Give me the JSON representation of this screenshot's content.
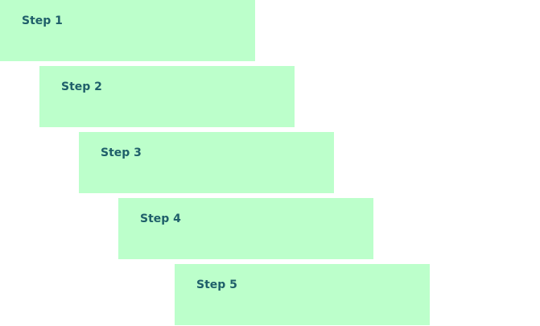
{
  "theme": {
    "box_color": "#bcffcb",
    "text_color": "#1f5f6a",
    "background": "#ffffff"
  },
  "steps": [
    {
      "label": "Step 1"
    },
    {
      "label": "Step 2"
    },
    {
      "label": "Step 3"
    },
    {
      "label": "Step 4"
    },
    {
      "label": "Step 5"
    }
  ]
}
